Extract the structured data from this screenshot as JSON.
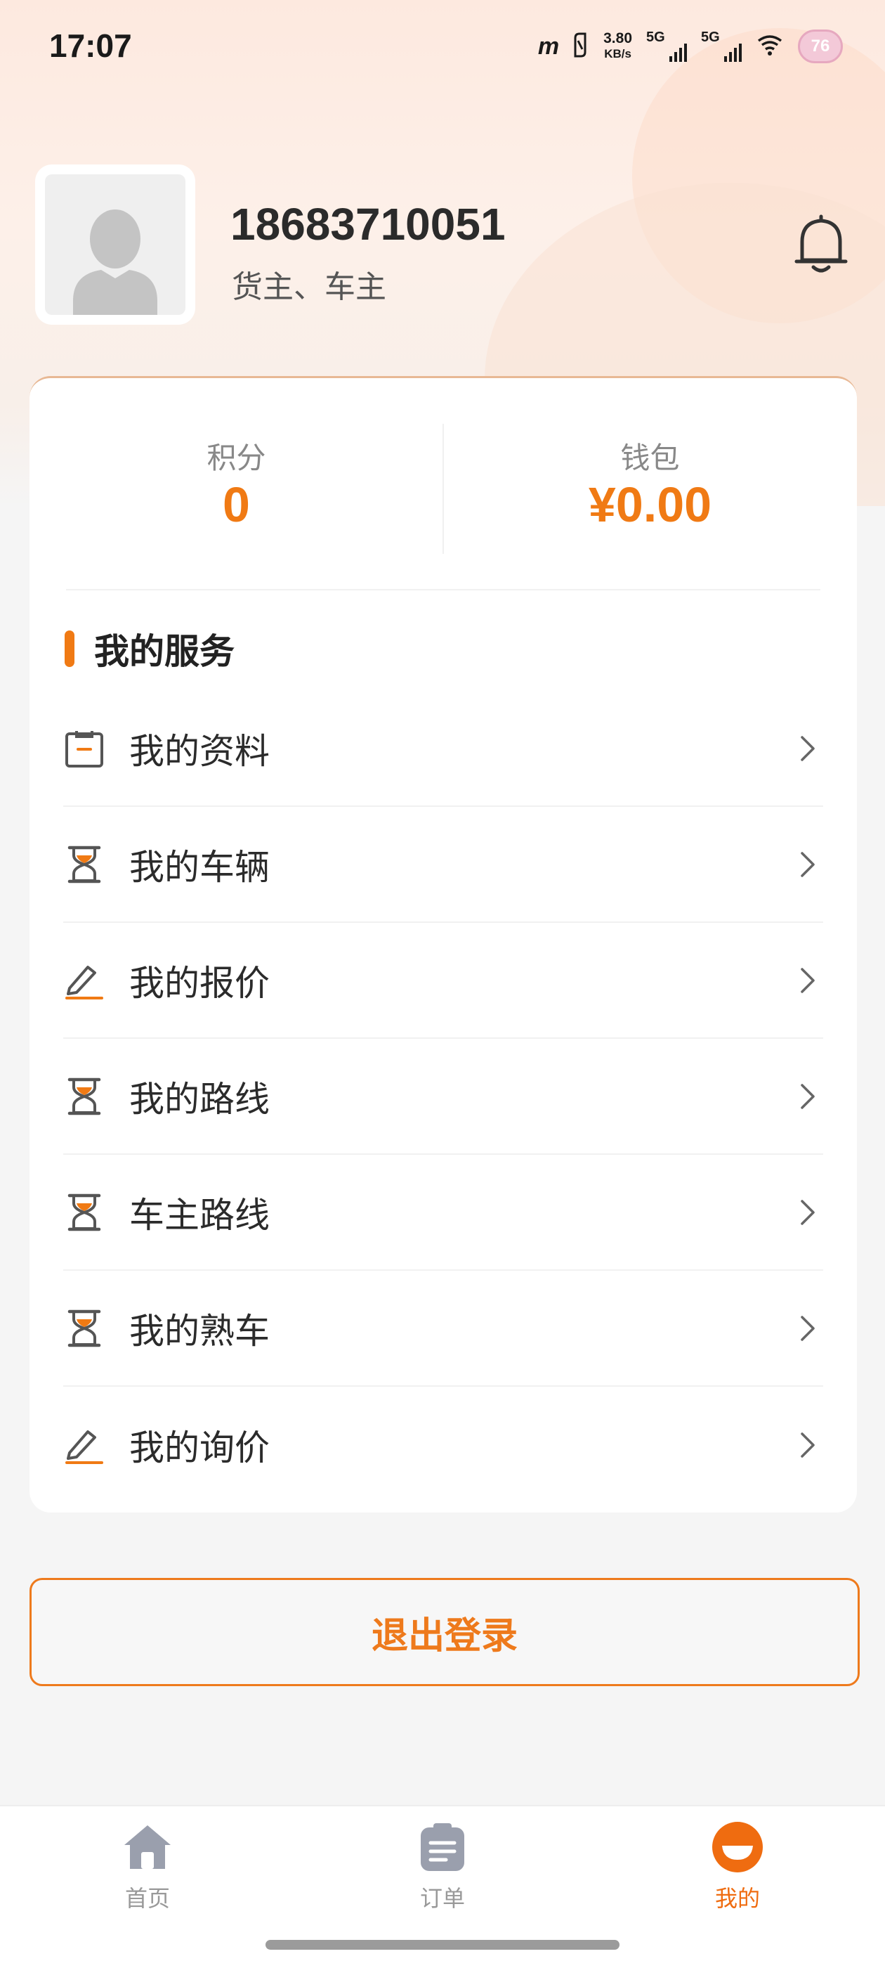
{
  "status_bar": {
    "time": "17:07",
    "carrier_logo": "m",
    "speed_value": "3.80",
    "speed_unit": "KB/s",
    "sim1_label": "5G",
    "sim2_label": "5G",
    "battery_level": "76"
  },
  "profile": {
    "phone": "18683710051",
    "roles": "货主、车主"
  },
  "stats": [
    {
      "label": "积分",
      "value": "0"
    },
    {
      "label": "钱包",
      "value": "¥0.00"
    }
  ],
  "services": {
    "title": "我的服务",
    "items": [
      {
        "label": "我的资料",
        "icon": "clipboard-icon"
      },
      {
        "label": "我的车辆",
        "icon": "hourglass-icon"
      },
      {
        "label": "我的报价",
        "icon": "edit-pencil-icon"
      },
      {
        "label": "我的路线",
        "icon": "hourglass-icon"
      },
      {
        "label": "车主路线",
        "icon": "hourglass-icon"
      },
      {
        "label": "我的熟车",
        "icon": "hourglass-icon"
      },
      {
        "label": "我的询价",
        "icon": "edit-pencil-icon"
      }
    ]
  },
  "logout_label": "退出登录",
  "tabs": [
    {
      "label": "首页",
      "icon": "home-icon",
      "active": false
    },
    {
      "label": "订单",
      "icon": "order-list-icon",
      "active": false
    },
    {
      "label": "我的",
      "icon": "profile-face-icon",
      "active": true
    }
  ],
  "colors": {
    "accent": "#f07a14",
    "icon_gray": "#555555",
    "tab_inactive": "#999999"
  }
}
